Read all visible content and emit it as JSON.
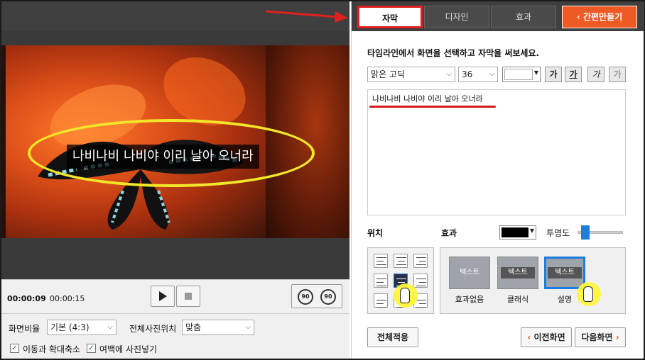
{
  "tabs": [
    {
      "label": "자막"
    },
    {
      "label": "디자인"
    },
    {
      "label": "효과"
    },
    {
      "label": "간편만들기"
    }
  ],
  "preview": {
    "subtitle_text": "나비나비 나비야 이리 날아 오너라"
  },
  "playback": {
    "current_time": "00:00:09",
    "total_time": "00:00:15",
    "rotate_left_label": "90",
    "rotate_right_label": "90"
  },
  "options": {
    "aspect_label": "화면비율",
    "aspect_value": "기본 (4:3)",
    "photo_pos_label": "전체사진위치",
    "photo_pos_value": "맞춤",
    "pan_zoom_label": "이동과 확대축소",
    "pan_zoom_checked": "✓",
    "margin_photo_label": "여백에 사진넣기",
    "margin_photo_checked": "✓"
  },
  "subtitle_panel": {
    "instruction": "타임라인에서 화면을 선택하고 자막을 써보세요.",
    "font_value": "맑은 고딕",
    "size_value": "36",
    "style_buttons": [
      "가",
      "가",
      "가",
      "가"
    ],
    "text_content": "나비나비 나비야 이리 날아 오너라",
    "position_label": "위치",
    "effect_label": "효과",
    "opacity_label": "투명도",
    "opacity_value": 0.05,
    "effects": [
      {
        "preview_text": "텍스트",
        "label": "효과없음"
      },
      {
        "preview_text": "텍스트",
        "label": "클래식"
      },
      {
        "preview_text": "텍스트",
        "label": "설명"
      }
    ],
    "apply_all_label": "전체적용",
    "prev_label": "이전화면",
    "next_label": "다음화면"
  },
  "colors": {
    "accent": "#ee5a24",
    "highlight_red": "#e0201e",
    "selected_blue": "#1e7be0",
    "annotation_yellow": "#f2e62a"
  },
  "icons": [
    "play-icon",
    "stop-icon",
    "rotate-left-icon",
    "rotate-right-icon",
    "chevron-down-icon",
    "hand-cursor-icon",
    "chevron-left-icon",
    "chevron-right-icon",
    "red-arrow-icon"
  ]
}
